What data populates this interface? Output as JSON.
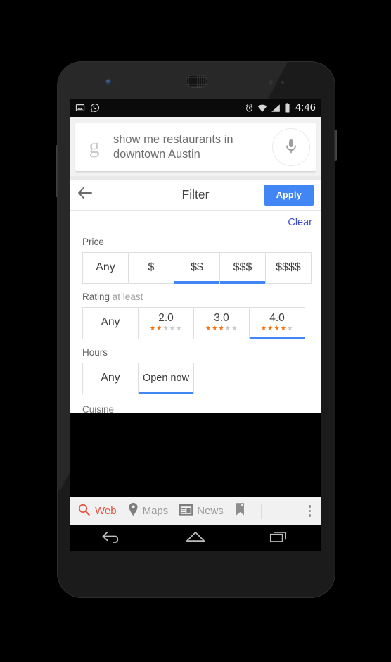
{
  "device": {
    "name": "android-phone",
    "model_hint": "nexus-style-handset"
  },
  "status_bar": {
    "left_icons": [
      "image-icon",
      "whatsapp-icon"
    ],
    "right_icons": [
      "alarm-icon",
      "wifi-icon",
      "signal-icon",
      "battery-icon"
    ],
    "time": "4:46"
  },
  "search": {
    "logo": "g",
    "query": "show me restaurants in downtown Austin",
    "mic_icon": "microphone-icon"
  },
  "filter": {
    "back_icon": "back-arrow-icon",
    "title": "Filter",
    "apply_label": "Apply",
    "clear_label": "Clear",
    "accent_color": "#4285f4",
    "link_color": "#3b4cca",
    "sections": {
      "price": {
        "label": "Price",
        "options": [
          {
            "label": "Any",
            "selected": false
          },
          {
            "label": "$",
            "selected": false
          },
          {
            "label": "$$",
            "selected": true
          },
          {
            "label": "$$$",
            "selected": true
          },
          {
            "label": "$$$$",
            "selected": false
          }
        ]
      },
      "rating": {
        "label": "Rating",
        "label_suffix": "at least",
        "star_color": "#f4700d",
        "star_empty_color": "#c9c9c9",
        "options": [
          {
            "label": "Any",
            "stars_filled": 0,
            "stars_total": 0,
            "selected": false
          },
          {
            "label": "2.0",
            "stars_filled": 2,
            "stars_total": 5,
            "selected": false
          },
          {
            "label": "3.0",
            "stars_filled": 3,
            "stars_total": 5,
            "selected": false
          },
          {
            "label": "4.0",
            "stars_filled": 4,
            "stars_total": 5,
            "selected": true
          }
        ]
      },
      "hours": {
        "label": "Hours",
        "options": [
          {
            "label": "Any",
            "selected": false
          },
          {
            "label": "Open now",
            "selected": true
          }
        ]
      },
      "cuisine": {
        "label": "Cuisine"
      }
    }
  },
  "tabbar": {
    "tabs": [
      {
        "label": "Web",
        "icon": "search-icon",
        "active": true
      },
      {
        "label": "Maps",
        "icon": "map-pin-icon",
        "active": false
      },
      {
        "label": "News",
        "icon": "newspaper-icon",
        "active": false
      },
      {
        "label": "",
        "icon": "bookmark-icon",
        "active": false
      }
    ],
    "overflow_icon": "kebab-menu-icon",
    "active_color": "#e8503a"
  },
  "nav_bar": {
    "buttons": [
      {
        "name": "back",
        "icon": "back-nav-icon"
      },
      {
        "name": "home",
        "icon": "home-nav-icon"
      },
      {
        "name": "recents",
        "icon": "recents-nav-icon"
      }
    ]
  }
}
